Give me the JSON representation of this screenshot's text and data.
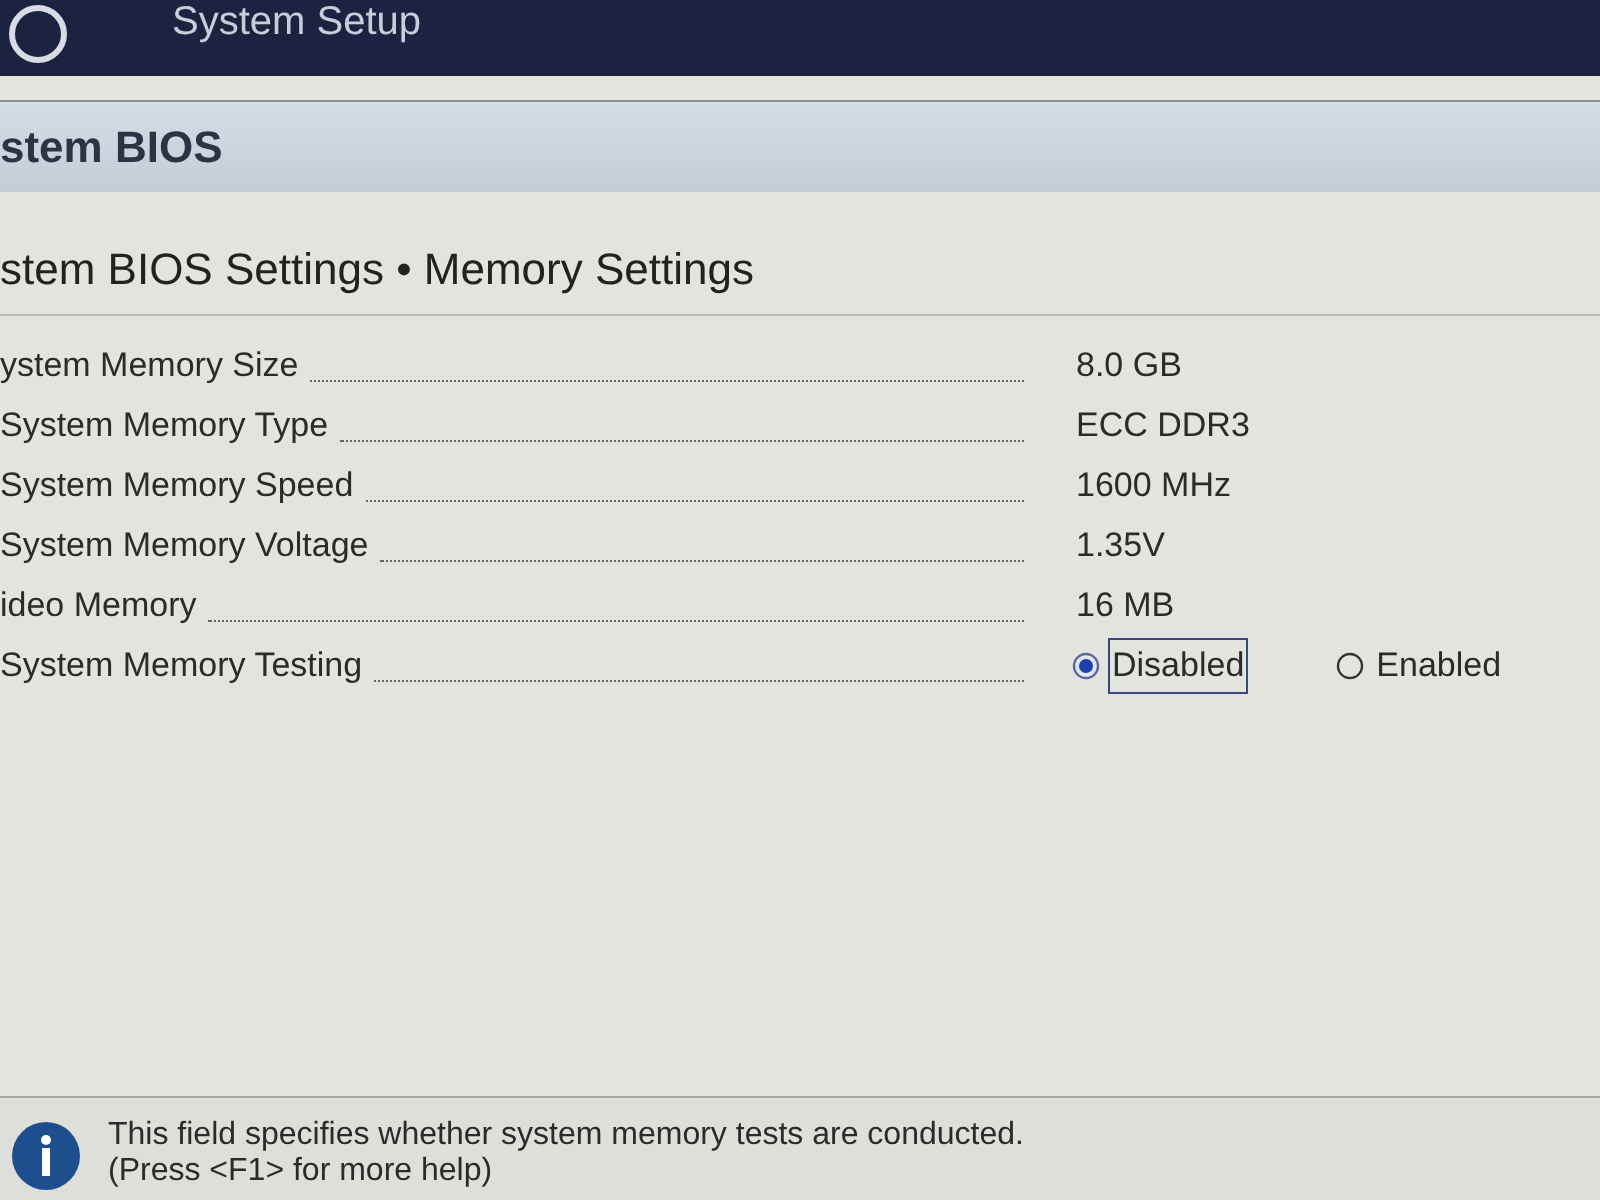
{
  "header": {
    "title": "System Setup"
  },
  "section": {
    "title": "stem BIOS"
  },
  "breadcrumb": "stem BIOS Settings • Memory Settings",
  "settings": [
    {
      "kind": "info",
      "label": "ystem Memory Size",
      "value": "8.0 GB"
    },
    {
      "kind": "info",
      "label": "System Memory Type",
      "value": "ECC DDR3"
    },
    {
      "kind": "info",
      "label": "System Memory Speed",
      "value": "1600 MHz"
    },
    {
      "kind": "info",
      "label": "System Memory Voltage",
      "value": "1.35V"
    },
    {
      "kind": "info",
      "label": "ideo Memory",
      "value": "16 MB"
    },
    {
      "kind": "radio",
      "label": "System Memory Testing",
      "options": [
        {
          "label": "Disabled",
          "selected": true,
          "focused": true
        },
        {
          "label": "Enabled",
          "selected": false,
          "focused": false
        }
      ]
    }
  ],
  "help": {
    "lines": [
      "This field specifies whether system memory tests are conducted.",
      "(Press <F1> for more help)"
    ]
  }
}
